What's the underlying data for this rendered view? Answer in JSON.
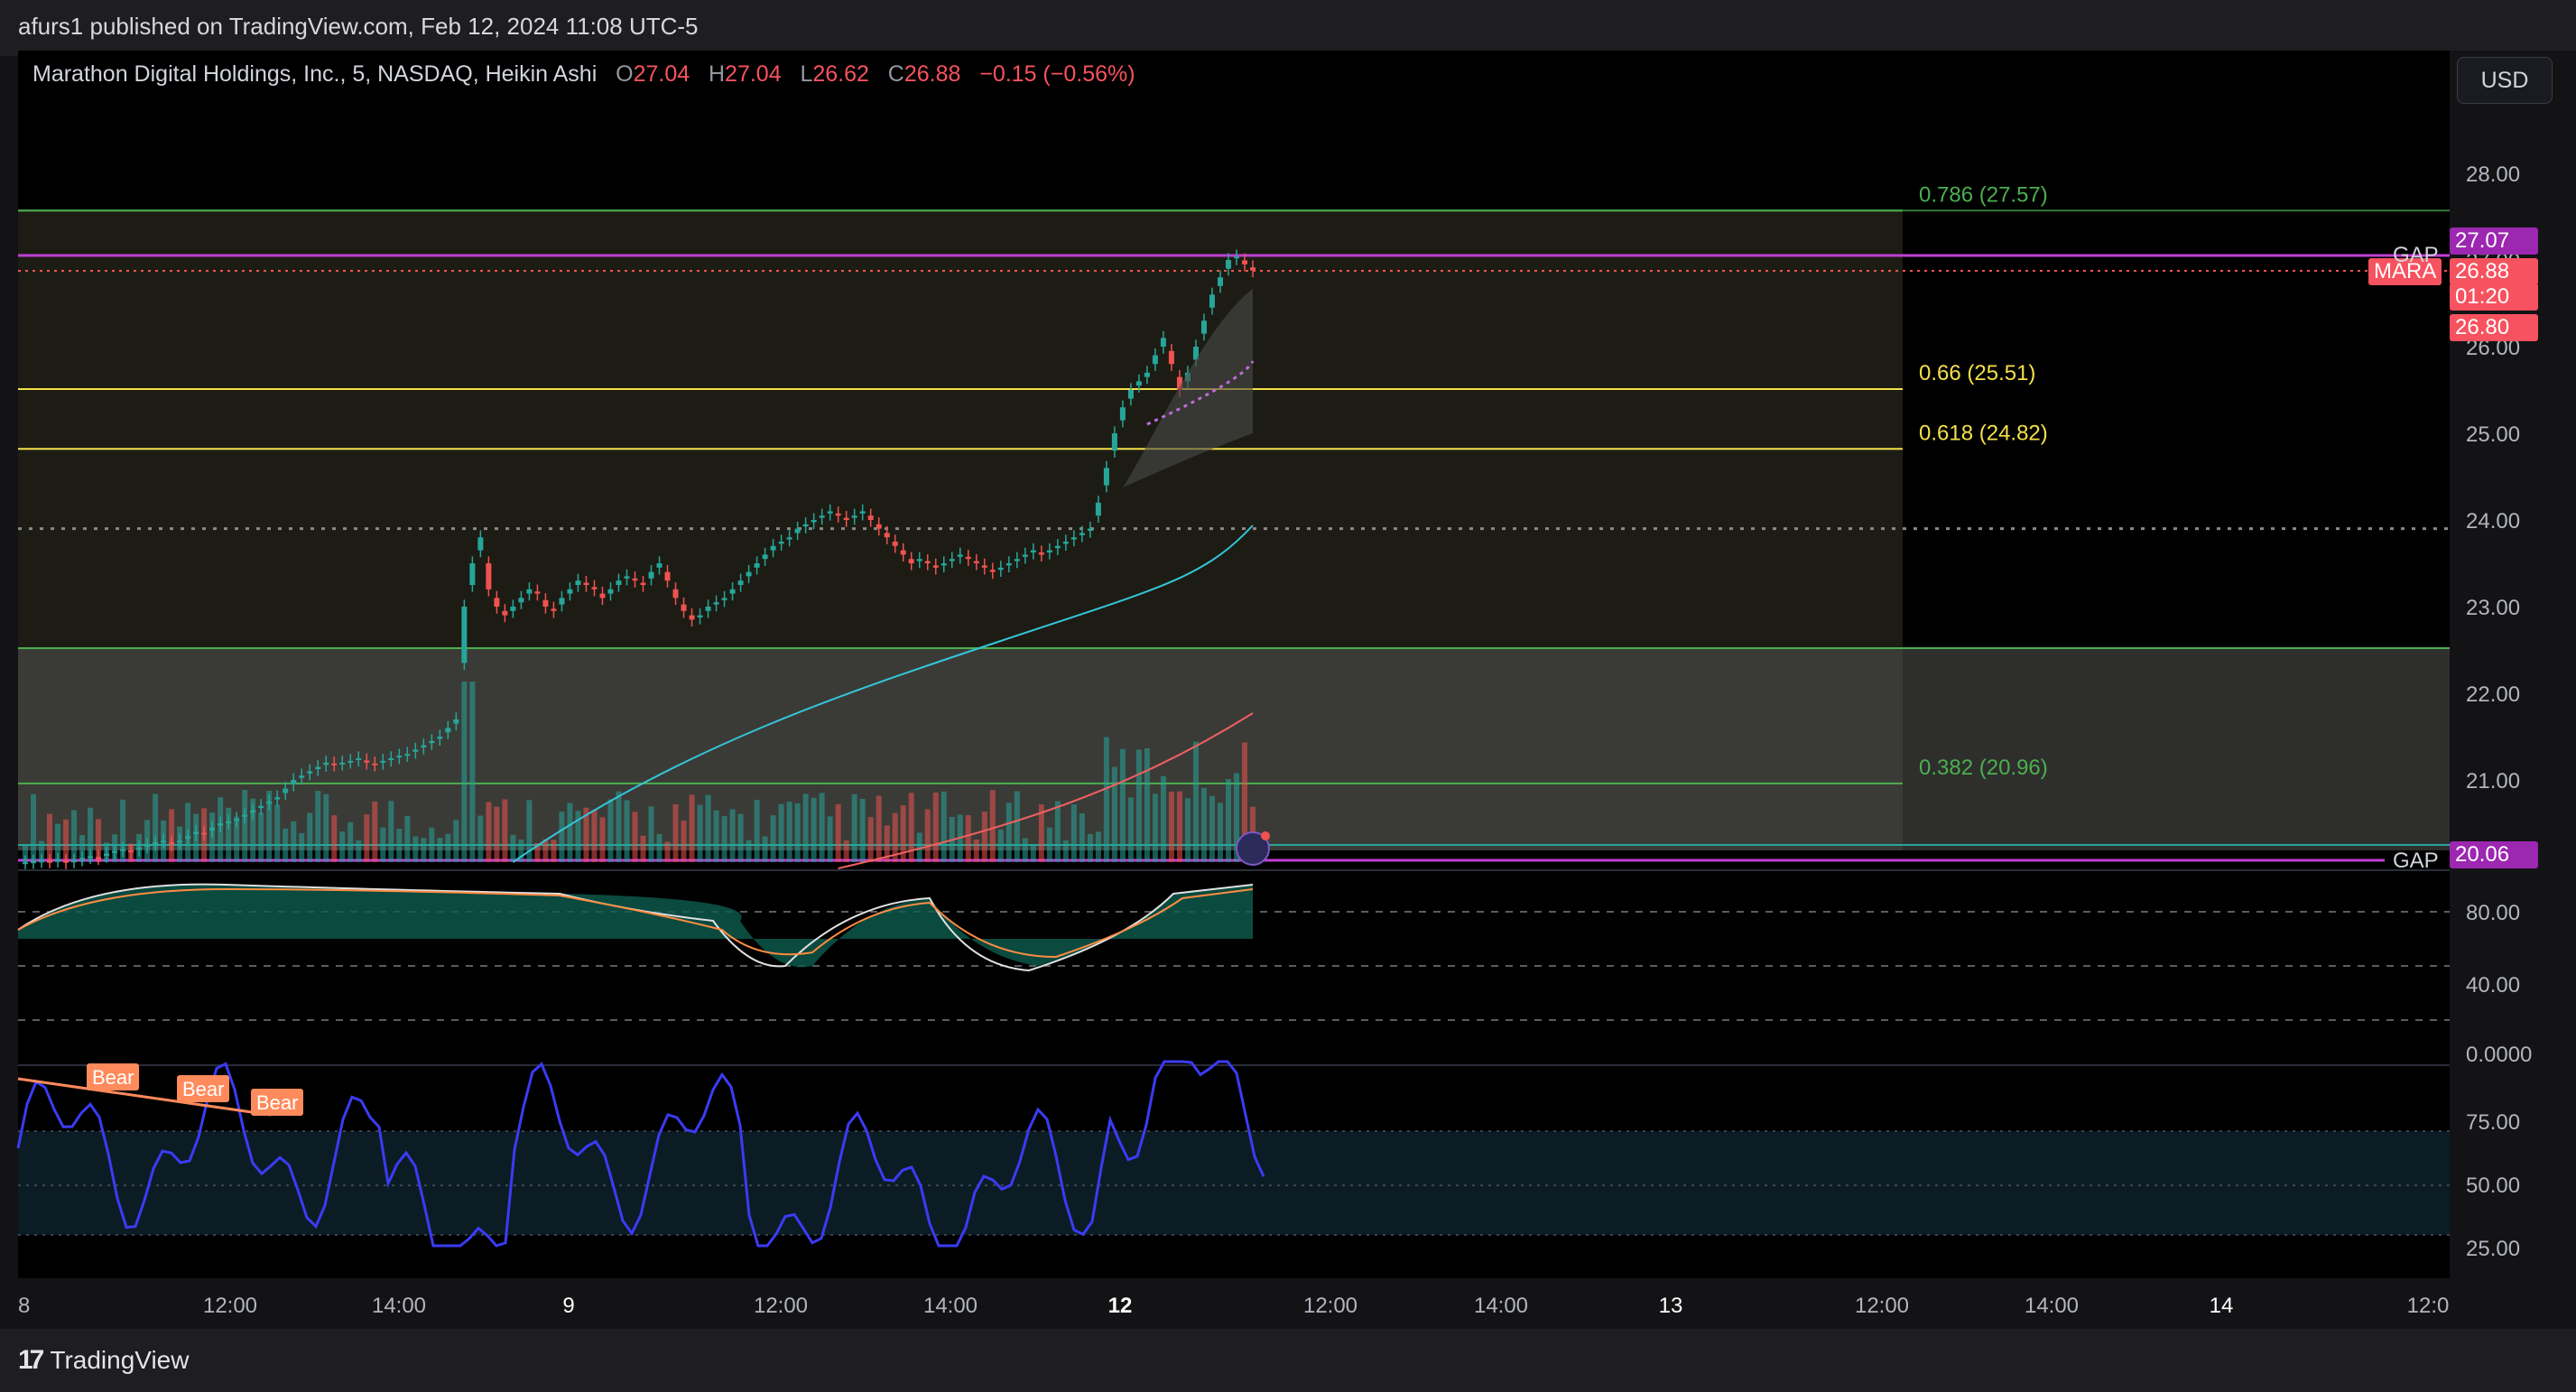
{
  "header": {
    "published_by": "afurs1 published on TradingView.com, Feb 12, 2024 11:08 UTC-5"
  },
  "legend": {
    "symbol": "Marathon Digital Holdings, Inc., 5, NASDAQ, Heikin Ashi",
    "o_label": "O",
    "o_value": "27.04",
    "h_label": "H",
    "h_value": "27.04",
    "l_label": "L",
    "l_value": "26.62",
    "c_label": "C",
    "c_value": "26.88",
    "change": "−0.15 (−0.56%)"
  },
  "currency_button": "USD",
  "footer": {
    "brand": "TradingView",
    "logo_text": "17"
  },
  "price_tags": {
    "gap_top_price": "27.07",
    "mara_label": "MARA",
    "mara_price": "26.88",
    "countdown": "01:20",
    "low_price": "26.80",
    "gap_bottom_price": "20.06",
    "gap_top_label": "GAP",
    "gap_bottom_label": "GAP"
  },
  "colors": {
    "background": "#000000",
    "panel": "#131316",
    "up": "#26a69a",
    "down": "#ef5350",
    "gap_line": "#c13fd6",
    "fib_green": "#4caf50",
    "fib_yellow": "#f5e04a",
    "rsi_line": "#3b3bf5",
    "ma_cyan": "#34c6d8",
    "ma_red": "#f06060",
    "bear_tag": "#ff8a5b"
  },
  "chart_data": {
    "type": "candlestick",
    "style": "Heikin Ashi",
    "symbol": "MARA",
    "exchange": "NASDAQ",
    "interval": "5",
    "ylim": [
      19.9,
      28.3
    ],
    "price_axis_ticks": [
      "28.00",
      "27.00",
      "26.00",
      "25.00",
      "24.00",
      "23.00",
      "22.00",
      "21.00"
    ],
    "time_axis_ticks": [
      "8",
      "12:00",
      "14:00",
      "9",
      "12:00",
      "14:00",
      "12",
      "12:00",
      "14:00",
      "13",
      "12:00",
      "14:00",
      "14",
      "12:0"
    ],
    "fib_levels": [
      {
        "label": "0.786 (27.57)",
        "price": 27.57
      },
      {
        "label": "0.66 (25.51)",
        "price": 25.51
      },
      {
        "label": "0.618 (24.82)",
        "price": 24.82
      },
      {
        "label": "0.382 (20.96)",
        "price": 20.96
      }
    ],
    "gap_levels": [
      27.07,
      20.06
    ],
    "last_price": 26.88,
    "dotted_level": 23.9,
    "candles_closes": [
      20.05,
      20.06,
      20.07,
      20.06,
      20.08,
      20.05,
      20.07,
      20.1,
      20.12,
      20.1,
      20.15,
      20.18,
      20.2,
      20.17,
      20.22,
      20.25,
      20.28,
      20.3,
      20.26,
      20.3,
      20.35,
      20.4,
      20.38,
      20.45,
      20.5,
      20.52,
      20.55,
      20.6,
      20.65,
      20.7,
      20.75,
      20.8,
      20.9,
      21.0,
      21.05,
      21.1,
      21.15,
      21.2,
      21.18,
      21.2,
      21.22,
      21.25,
      21.2,
      21.18,
      21.22,
      21.25,
      21.28,
      21.3,
      21.35,
      21.4,
      21.45,
      21.5,
      21.6,
      21.7,
      23.0,
      23.5,
      23.8,
      23.2,
      23.0,
      22.9,
      23.0,
      23.1,
      23.2,
      23.15,
      23.0,
      22.95,
      23.1,
      23.2,
      23.3,
      23.25,
      23.2,
      23.1,
      23.2,
      23.3,
      23.35,
      23.3,
      23.25,
      23.4,
      23.5,
      23.3,
      23.1,
      22.95,
      22.85,
      22.9,
      23.0,
      23.05,
      23.1,
      23.2,
      23.3,
      23.4,
      23.5,
      23.6,
      23.7,
      23.75,
      23.8,
      23.9,
      23.95,
      24.0,
      24.05,
      24.1,
      24.05,
      24.0,
      24.05,
      24.1,
      24.0,
      23.9,
      23.8,
      23.7,
      23.6,
      23.5,
      23.55,
      23.5,
      23.45,
      23.5,
      23.55,
      23.6,
      23.55,
      23.5,
      23.45,
      23.4,
      23.45,
      23.5,
      23.55,
      23.6,
      23.65,
      23.6,
      23.65,
      23.7,
      23.75,
      23.8,
      23.85,
      23.9,
      24.2,
      24.6,
      25.0,
      25.3,
      25.5,
      25.6,
      25.7,
      25.9,
      26.1,
      25.8,
      25.5,
      25.7,
      26.0,
      26.3,
      26.6,
      26.8,
      27.0,
      27.04,
      26.95,
      26.88
    ],
    "rsi_panel": {
      "ticks": [
        "80.00",
        "40.00",
        "0.0000"
      ]
    },
    "oscillator_panel": {
      "ticks": [
        "75.00",
        "50.00",
        "25.00"
      ],
      "annotations": [
        "Bear",
        "Bear",
        "Bear"
      ]
    }
  }
}
